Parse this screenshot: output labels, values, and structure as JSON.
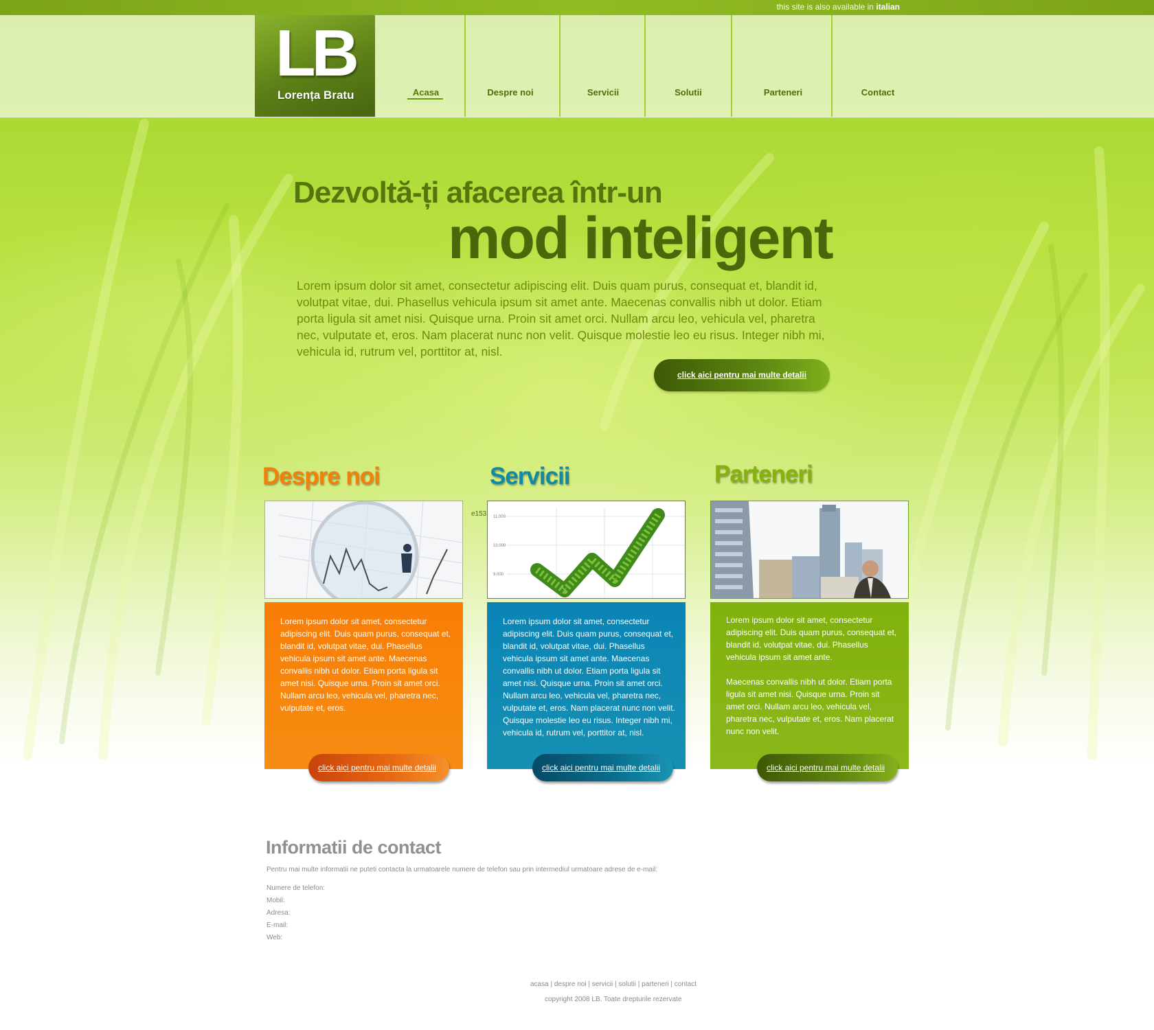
{
  "topbar": {
    "language_note": "this site is also available in",
    "language_link": "italian"
  },
  "logo": {
    "initials": "LB",
    "name": "Lorența Bratu"
  },
  "nav": {
    "items": [
      {
        "label": "Acasa",
        "active": true
      },
      {
        "label": "Despre noi"
      },
      {
        "label": "Servicii"
      },
      {
        "label": "Solutii"
      },
      {
        "label": "Parteneri"
      },
      {
        "label": "Contact"
      }
    ]
  },
  "hero": {
    "line1": "Dezvoltă-ți afacerea într-un",
    "line2": "mod inteligent",
    "text": "Lorem ipsum dolor sit amet, consectetur adipiscing elit. Duis quam purus, consequat et, blandit id, volutpat vitae, dui. Phasellus vehicula ipsum sit amet ante. Maecenas convallis nibh ut dolor. Etiam porta ligula sit amet nisi. Quisque urna. Proin sit amet orci. Nullam arcu leo, vehicula vel, pharetra nec, vulputate et, eros. Nam placerat nunc non velit. Quisque molestie leo eu risus. Integer nibh mi, vehicula id, rutrum vel, porttitor at, nisl.",
    "button": "click aici pentru mai multe detalii"
  },
  "columns": [
    {
      "title": "Despre noi",
      "color": "#f5840e",
      "text": "Lorem ipsum dolor sit amet, consectetur adipiscing elit. Duis quam purus, consequat et, blandit id, volutpat vitae, dui. Phasellus vehicula ipsum sit amet ante. Maecenas convallis nibh ut dolor. Etiam porta ligula sit amet nisi. Quisque urna. Proin sit amet orci. Nullam arcu leo, vehicula vel, pharetra nec, vulputate et, eros.",
      "button": "click aici pentru mai multe detalii"
    },
    {
      "title": "Servicii",
      "color": "#0e87b5",
      "chart_ticks": [
        "11.000",
        "10.000",
        "9.000"
      ],
      "text": "Lorem ipsum dolor sit amet, consectetur adipiscing elit. Duis quam purus, consequat et, blandit id, volutpat vitae, dui. Phasellus vehicula ipsum sit amet ante. Maecenas convallis nibh ut dolor. Etiam porta ligula sit amet nisi. Quisque urna. Proin sit amet orci. Nullam arcu leo, vehicula vel, pharetra nec, vulputate et, eros. Nam placerat nunc non velit. Quisque molestie leo eu risus. Integer nibh mi, vehicula id, rutrum vel, porttitor at, nisl.",
      "button": "click aici pentru mai multe detalii"
    },
    {
      "title": "Parteneri",
      "color": "#84b312",
      "text1": "Lorem ipsum dolor sit amet, consectetur adipiscing elit. Duis quam purus, consequat et, blandit id, volutpat vitae, dui. Phasellus vehicula ipsum sit amet ante.",
      "text2": "Maecenas convallis nibh ut dolor. Etiam porta ligula sit amet nisi. Quisque urna. Proin sit amet orci. Nullam arcu leo, vehicula vel, pharetra nec, vulputate et, eros. Nam placerat nunc non velit.",
      "button": "click aici pentru mai multe detalii"
    }
  ],
  "stray_text": "e153",
  "contact": {
    "title": "Informatii de contact",
    "intro": "Pentru mai multe informatii ne puteti contacta la urmatoarele numere de telefon sau prin intermediul urmatoare adrese de e-mail:",
    "lines": [
      "Numere de telefon:",
      "Mobil:",
      "Adresa:",
      "E-mail:",
      "Web:"
    ]
  },
  "footer": {
    "links": [
      "acasa",
      "despre noi",
      "servicii",
      "solutii",
      "parteneri",
      "contact"
    ],
    "separator": " | ",
    "copyright": "copyright 2008 LB. Toate drepturile rezervate"
  }
}
